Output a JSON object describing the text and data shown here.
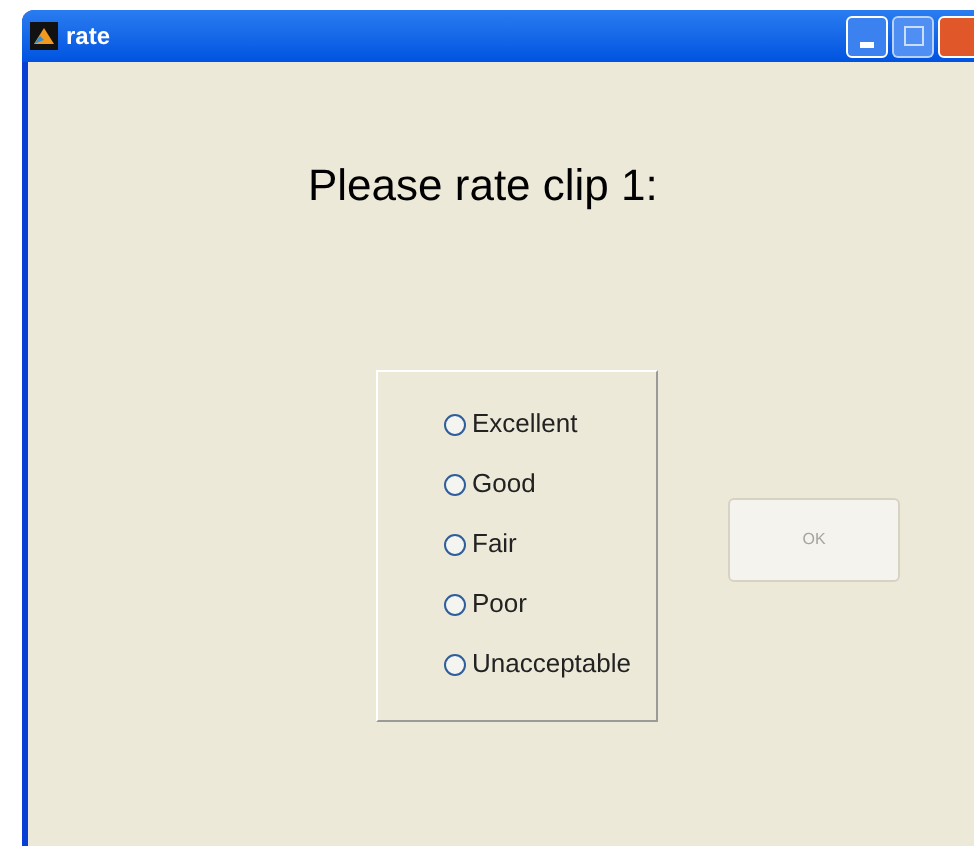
{
  "window": {
    "title": "rate"
  },
  "prompt": "Please rate clip 1:",
  "options": [
    {
      "label": "Excellent",
      "selected": false
    },
    {
      "label": "Good",
      "selected": false
    },
    {
      "label": "Fair",
      "selected": false
    },
    {
      "label": "Poor",
      "selected": false
    },
    {
      "label": "Unacceptable",
      "selected": false
    }
  ],
  "ok_button": {
    "label": "OK",
    "disabled": true
  }
}
